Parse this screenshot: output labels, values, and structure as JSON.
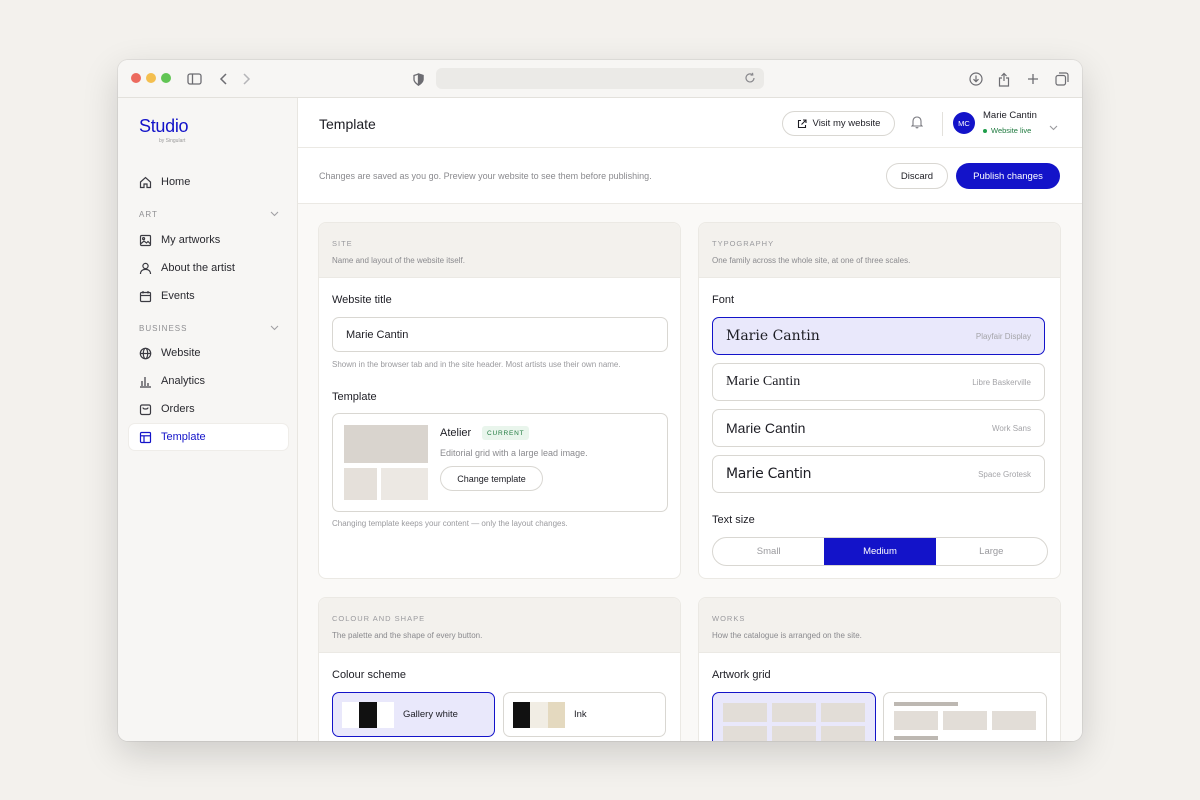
{
  "app": {
    "logo": "Studio",
    "logo_sub": "by Singulart"
  },
  "sidebar": {
    "home": "Home",
    "sections": [
      {
        "label": "ART",
        "items": [
          "My artworks",
          "About the artist",
          "Events"
        ]
      },
      {
        "label": "BUSINESS",
        "items": [
          "Website",
          "Analytics",
          "Orders",
          "Template"
        ]
      }
    ],
    "active_item": "Template"
  },
  "header": {
    "title": "Template",
    "visit_label": "Visit my website",
    "user": {
      "initials": "MC",
      "name": "Marie Cantin",
      "status": "Website live"
    }
  },
  "subbar": {
    "notice": "Changes are saved as you go. Preview your website to see them before publishing.",
    "discard_label": "Discard",
    "publish_label": "Publish changes"
  },
  "site_card": {
    "kicker": "SITE",
    "desc": "Name and layout of the website itself.",
    "title_label": "Website title",
    "title_value": "Marie Cantin",
    "title_hint": "Shown in the browser tab and in the site header. Most artists use their own name.",
    "template_label": "Template",
    "template_name": "Atelier",
    "template_badge": "CURRENT",
    "template_desc": "Editorial grid with a large lead image.",
    "change_label": "Change template",
    "template_hint": "Changing template keeps your content — only the layout changes."
  },
  "typography_card": {
    "kicker": "TYPOGRAPHY",
    "desc": "One family across the whole site, at one of three scales.",
    "font_label": "Font",
    "fonts": [
      {
        "sample": "Marie Cantin",
        "name": "Playfair Display",
        "selected": true
      },
      {
        "sample": "Marie Cantin",
        "name": "Libre Baskerville",
        "selected": false
      },
      {
        "sample": "Marie Cantin",
        "name": "Work Sans",
        "selected": false
      },
      {
        "sample": "Marie Cantin",
        "name": "Space Grotesk",
        "selected": false
      }
    ],
    "size_label": "Text size",
    "sizes": [
      "Small",
      "Medium",
      "Large"
    ],
    "selected_size": "Medium"
  },
  "colour_card": {
    "kicker": "COLOUR AND SHAPE",
    "desc": "The palette and the shape of every button.",
    "scheme_label": "Colour scheme",
    "schemes": [
      {
        "name": "Gallery white",
        "colors": [
          "#ffffff",
          "#111111",
          "#ffffff"
        ],
        "selected": true
      },
      {
        "name": "Ink",
        "colors": [
          "#111111",
          "#f1ede4",
          "#e4d9bf"
        ],
        "selected": false
      }
    ]
  },
  "works_card": {
    "kicker": "WORKS",
    "desc": "How the catalogue is arranged on the site.",
    "grid_label": "Artwork grid"
  },
  "colors": {
    "accent": "#1313c9",
    "live": "#1f7a3f"
  }
}
